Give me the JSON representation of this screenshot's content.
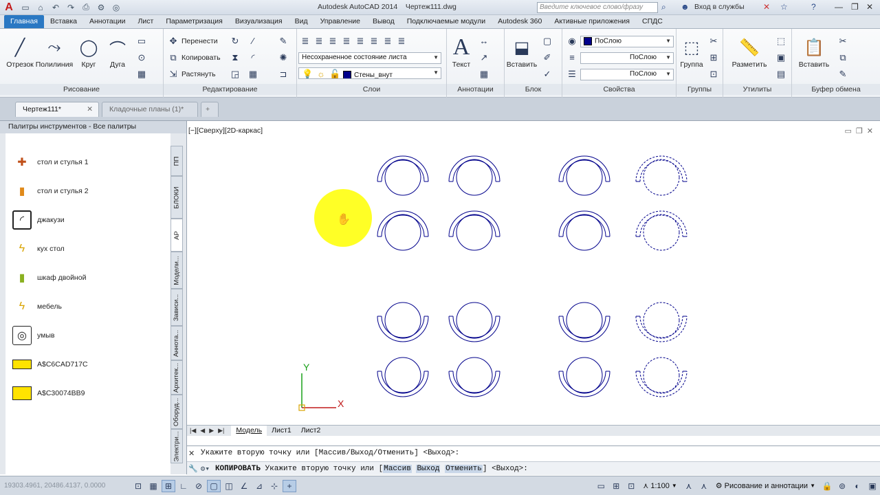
{
  "app": {
    "title": "Autodesk AutoCAD 2014",
    "document": "Чертеж111.dwg",
    "search_placeholder": "Введите ключевое слово/фразу",
    "signin": "Вход в службы"
  },
  "ribbon_tabs": [
    "Главная",
    "Вставка",
    "Аннотации",
    "Лист",
    "Параметризация",
    "Визуализация",
    "Вид",
    "Управление",
    "Вывод",
    "Подключаемые модули",
    "Autodesk 360",
    "Активные приложения",
    "СПДС"
  ],
  "panels": {
    "draw": {
      "title": "Рисование",
      "otrezok": "Отрезок",
      "polyline": "Полилиния",
      "circle": "Круг",
      "arc": "Дуга"
    },
    "modify": {
      "title": "Редактирование",
      "move": "Перенести",
      "copy": "Копировать",
      "stretch": "Растянуть"
    },
    "layers": {
      "title": "Слои",
      "layer_state": "Несохраненное состояние листа",
      "current_layer": "Стены_внут"
    },
    "annotations": {
      "title": "Аннотации",
      "text": "Текст"
    },
    "block": {
      "title": "Блок",
      "insert": "Вставить"
    },
    "properties": {
      "title": "Свойства",
      "color": "ПоСлою",
      "linetype": "ПоСлою",
      "lineweight": "ПоСлою"
    },
    "groups": {
      "title": "Группы",
      "group": "Группа"
    },
    "utilities": {
      "title": "Утилиты",
      "measure": "Разметить"
    },
    "clipboard": {
      "title": "Буфер обмена",
      "paste": "Вставить"
    }
  },
  "doc_tabs": [
    "Чертеж111*",
    "Кладочные планы (1)*"
  ],
  "palette": {
    "title": "Палитры инструментов - Все палитры",
    "items": [
      "стол и стулья 1",
      "стол и стулья 2",
      "джакузи",
      "кух стол",
      "шкаф двойной",
      "мебель",
      "умыв",
      "A$C6CAD717C",
      "A$C30074BB9"
    ],
    "vtabs": [
      "ПП",
      "БЛОКИ",
      "АР",
      "Модели...",
      "Зависи...",
      "Аннота...",
      "Архитек...",
      "Оборуд...",
      "Электри..."
    ]
  },
  "viewport_label": "[−][Сверху][2D-каркас]",
  "axis": {
    "y": "Y",
    "x": "X"
  },
  "layout_tabs": [
    "Модель",
    "Лист1",
    "Лист2"
  ],
  "command": {
    "history": "Укажите вторую точку или [Массив/Выход/Отменить] <Выход>:",
    "cmd_name": "КОПИРОВАТЬ",
    "prompt": "Укажите вторую точку или [",
    "opt1": "Массив",
    "opt2": "Выход",
    "opt3": "Отменить",
    "tail": "] <Выход>:"
  },
  "status": {
    "coords": "19303.4961, 20486.4137, 0.0000",
    "scale": "1:100",
    "workspace": "Рисование и аннотации"
  },
  "colors": {
    "accent": "#2a78c3",
    "drawing": "#00008b",
    "highlight": "#ffff00"
  }
}
